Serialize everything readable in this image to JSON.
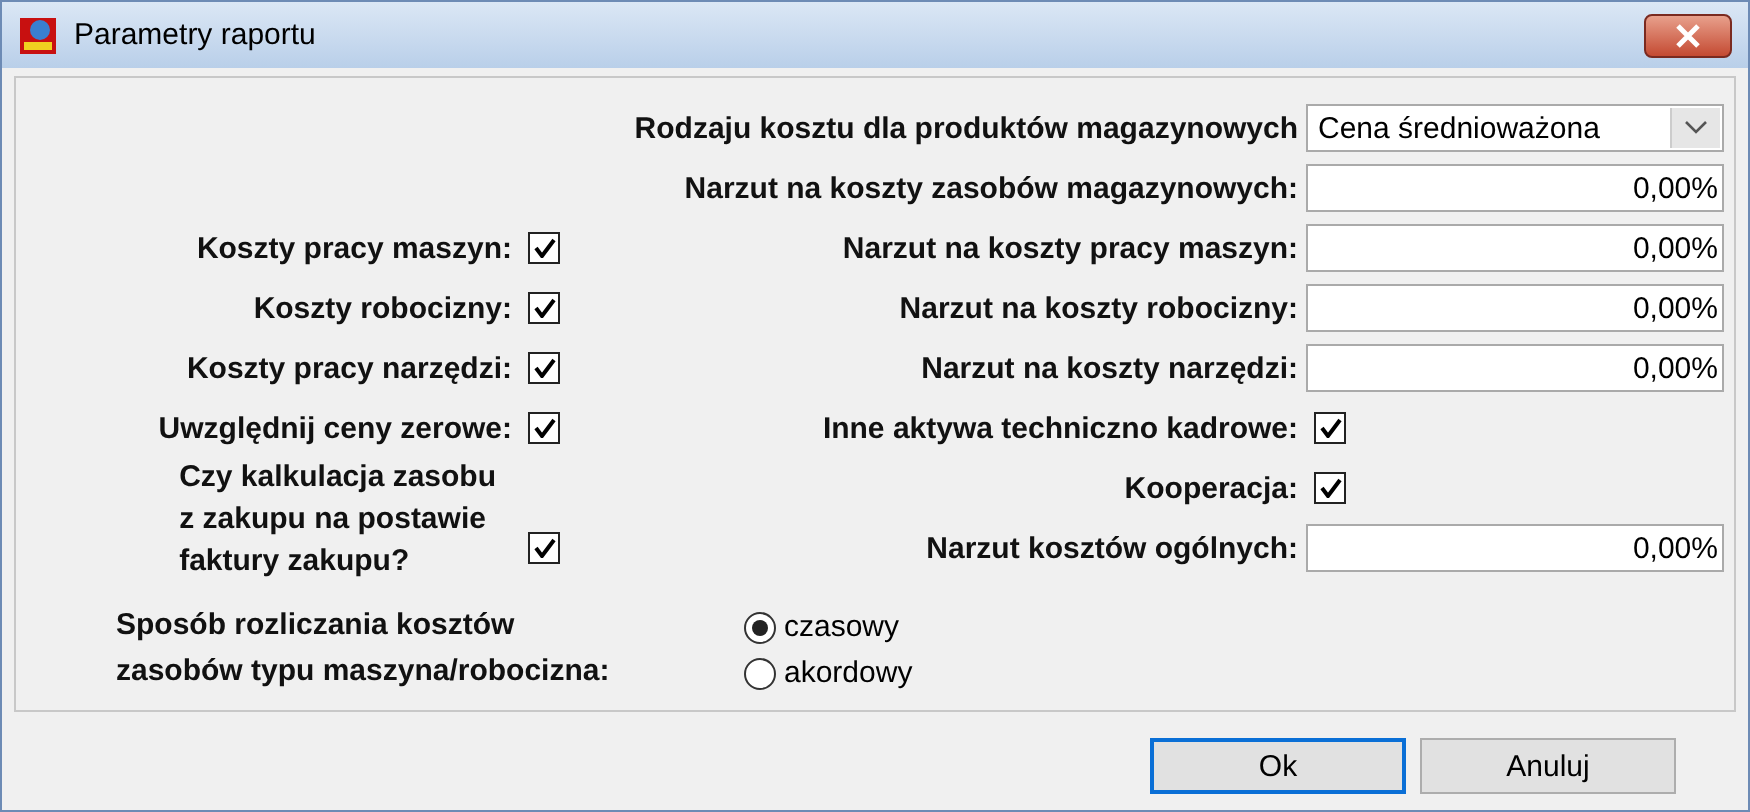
{
  "window": {
    "title": "Parametry raportu"
  },
  "cost_type": {
    "label": "Rodzaju kosztu dla produktów magazynowych",
    "value": "Cena średnioważona"
  },
  "left": [
    {
      "label": "Koszty pracy maszyn:",
      "checked": true
    },
    {
      "label": "Koszty robocizny:",
      "checked": true
    },
    {
      "label": "Koszty pracy narzędzi:",
      "checked": true
    },
    {
      "label": "Uwzględnij ceny zerowe:",
      "checked": true
    },
    {
      "label": "Czy kalkulacja zasobu\nz zakupu na postawie\nfaktury zakupu?",
      "checked": true
    }
  ],
  "right": [
    {
      "kind": "field",
      "label": "Narzut na koszty zasobów magazynowych:",
      "value": "0,00%"
    },
    {
      "kind": "field",
      "label": "Narzut na koszty pracy maszyn:",
      "value": "0,00%"
    },
    {
      "kind": "field",
      "label": "Narzut na koszty robocizny:",
      "value": "0,00%"
    },
    {
      "kind": "field",
      "label": "Narzut na koszty narzędzi:",
      "value": "0,00%"
    },
    {
      "kind": "check",
      "label": "Inne aktywa techniczno kadrowe:",
      "checked": true
    },
    {
      "kind": "check",
      "label": "Kooperacja:",
      "checked": true
    },
    {
      "kind": "field",
      "label": "Narzut kosztów ogólnych:",
      "value": "0,00%"
    }
  ],
  "settlement": {
    "label": "Sposób rozliczania kosztów\nzasobów typu maszyna/robocizna:",
    "options": [
      {
        "label": "czasowy",
        "selected": true
      },
      {
        "label": "akordowy",
        "selected": false
      }
    ]
  },
  "buttons": [
    {
      "label": "Ok",
      "focused": true
    },
    {
      "label": "Anuluj",
      "focused": false
    }
  ]
}
